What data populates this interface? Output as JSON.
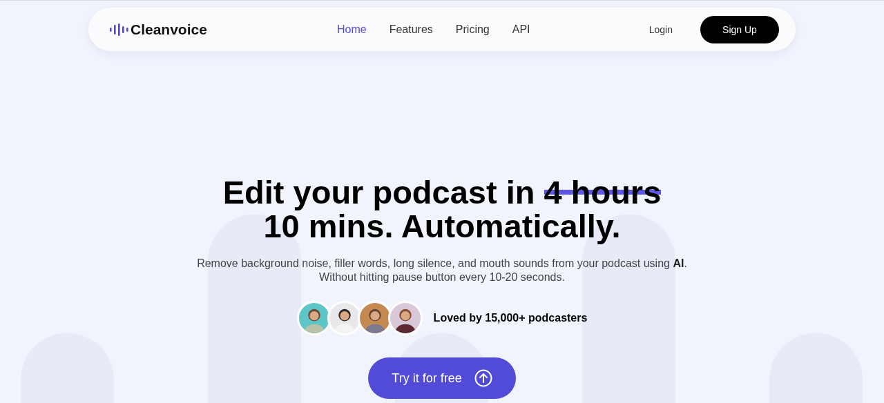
{
  "nav": {
    "brand": "Cleanvoice",
    "links": [
      {
        "label": "Home",
        "selected": true
      },
      {
        "label": "Features",
        "selected": false
      },
      {
        "label": "Pricing",
        "selected": false
      },
      {
        "label": "API",
        "selected": false
      }
    ],
    "login": "Login",
    "signup": "Sign Up"
  },
  "hero": {
    "headline_start": "Edit your podcast in",
    "struck": "4 hours",
    "headline_end": "10 mins. Automatically.",
    "subtitle": [
      "Remove background noise, filler words, long silence, and mouth sounds from your podcast using **AI**.",
      "Without hitting pause button every 10-20 seconds."
    ],
    "social_proof": "Loved by 15,000+ podcasters",
    "cta": "Try it for free"
  }
}
